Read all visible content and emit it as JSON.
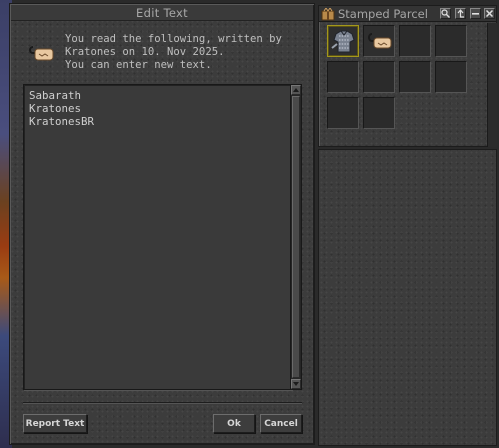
{
  "dialog": {
    "title": "Edit Text",
    "message": "You read the following, written by\nKratones on 10. Nov 2025.\nYou can enter new text.",
    "text_lines": [
      "Sabarath",
      "Kratones",
      "KratonesBR"
    ],
    "buttons": {
      "report": "Report Text",
      "ok": "Ok",
      "cancel": "Cancel"
    },
    "icon": "letter-icon"
  },
  "container": {
    "title": "Stamped Parcel",
    "icon": "parcel-icon",
    "header_buttons": [
      "search-icon",
      "up-arrow-icon",
      "minimize-icon",
      "close-icon"
    ],
    "slots": [
      {
        "item": "chain-armor",
        "selected": true
      },
      {
        "item": "letter",
        "selected": false
      },
      {
        "item": null
      },
      {
        "item": null
      },
      {
        "item": null
      },
      {
        "item": null
      },
      {
        "item": null
      },
      {
        "item": null
      },
      {
        "item": null
      },
      {
        "item": null
      }
    ]
  },
  "colors": {
    "selected_border": "#a3971c",
    "text": "#cfcfcf"
  }
}
